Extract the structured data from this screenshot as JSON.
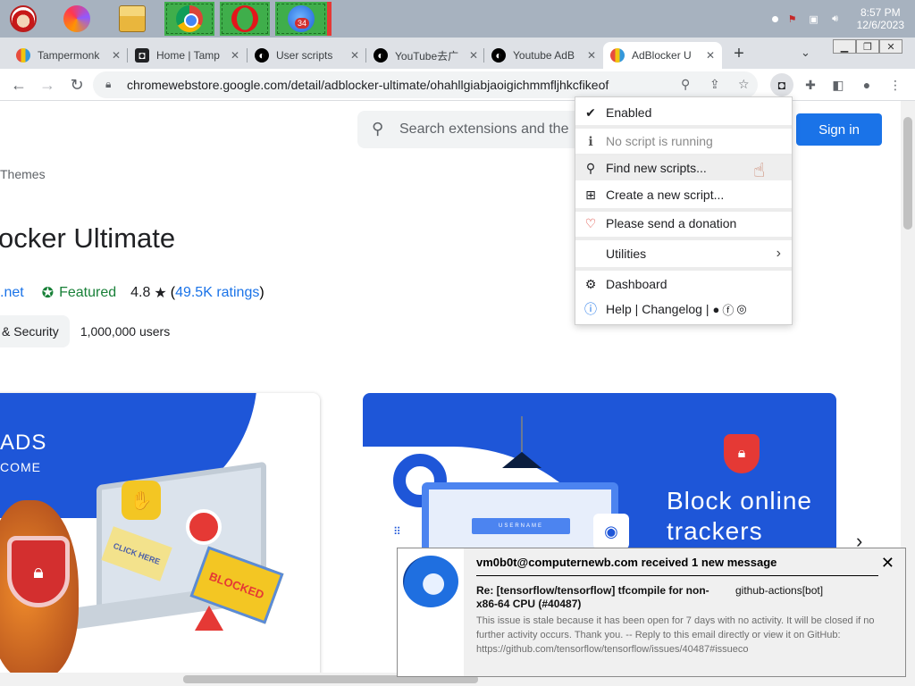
{
  "taskbar": {
    "apps": [
      {
        "name": "santa",
        "icon": "santa-claus-icon"
      },
      {
        "name": "firefox",
        "icon": "firefox-icon"
      },
      {
        "name": "explorer",
        "icon": "file-explorer-icon"
      },
      {
        "name": "chrome",
        "icon": "chrome-icon"
      },
      {
        "name": "opera",
        "icon": "opera-icon"
      },
      {
        "name": "mail",
        "icon": "mail-icon",
        "badge": "34"
      }
    ],
    "clock": {
      "time": "8:57 PM",
      "date": "12/6/2023"
    }
  },
  "tabs": [
    {
      "label": "Tampermonk",
      "icon": "tampermonkey-rainbow-icon"
    },
    {
      "label": "Home | Tamp",
      "icon": "tampermonkey-icon"
    },
    {
      "label": "User scripts",
      "icon": "greasyfork-icon"
    },
    {
      "label": "YouTube去广",
      "icon": "greasyfork-icon"
    },
    {
      "label": "Youtube AdB",
      "icon": "greasyfork-icon"
    },
    {
      "label": "AdBlocker U",
      "icon": "chrome-webstore-icon",
      "active": true
    }
  ],
  "toolbar": {
    "url": "chromewebstore.google.com/detail/adblocker-ultimate/ohahllgiabjaoigichmmfljhkcfikeof"
  },
  "page": {
    "search_placeholder": "Search extensions and the",
    "sign_in": "Sign in",
    "breadcrumb": "Themes",
    "title": "ocker Ultimate",
    "publisher_link": ".net",
    "featured": "Featured",
    "rating": "4.8",
    "ratings_open": "(",
    "ratings_count": "49.5K ratings",
    "ratings_close": ")",
    "category": "& Security",
    "users": "1,000,000 users",
    "card1": {
      "ads": "ADS",
      "come": "COME",
      "click_here": "CLICK HERE",
      "blocked": "BLOCKED"
    },
    "card2": {
      "line1": "Block online",
      "line2": "trackers",
      "field": "USERNAME"
    }
  },
  "popup": {
    "items": [
      {
        "label": "Enabled",
        "icon": "checkmark-icon"
      },
      {
        "label": "No script is running",
        "icon": "info-i-icon",
        "disabled": true
      },
      {
        "label": "Find new scripts...",
        "icon": "search-icon",
        "hover": true
      },
      {
        "label": "Create a new script...",
        "icon": "plus-square-icon"
      },
      {
        "label": "Please send a donation",
        "icon": "heart-icon"
      },
      {
        "label": "Utilities",
        "icon": ""
      },
      {
        "label": "Dashboard",
        "icon": "gear-icon"
      },
      {
        "label": "Help | Changelog |",
        "icon": "info-circle-icon"
      }
    ]
  },
  "notification": {
    "title": "vm0b0t@computernewb.com received 1 new message",
    "subject": "Re: [tensorflow/tensorflow] tfcompile for non-x86-64 CPU (#40487)",
    "from": "github-actions[bot]",
    "body": "This issue is stale because it has been open for 7 days with no activity. It will be closed if no further activity occurs. Thank you. -- Reply to this email directly or view it on GitHub: https://github.com/tensorflow/tensorflow/issues/40487#issueco"
  },
  "colors": {
    "accent": "#1a73e8",
    "featured": "#188038",
    "card_blue": "#1e56d8",
    "taskbar": "#a7b2bf",
    "running_app": "#3fae4b"
  }
}
